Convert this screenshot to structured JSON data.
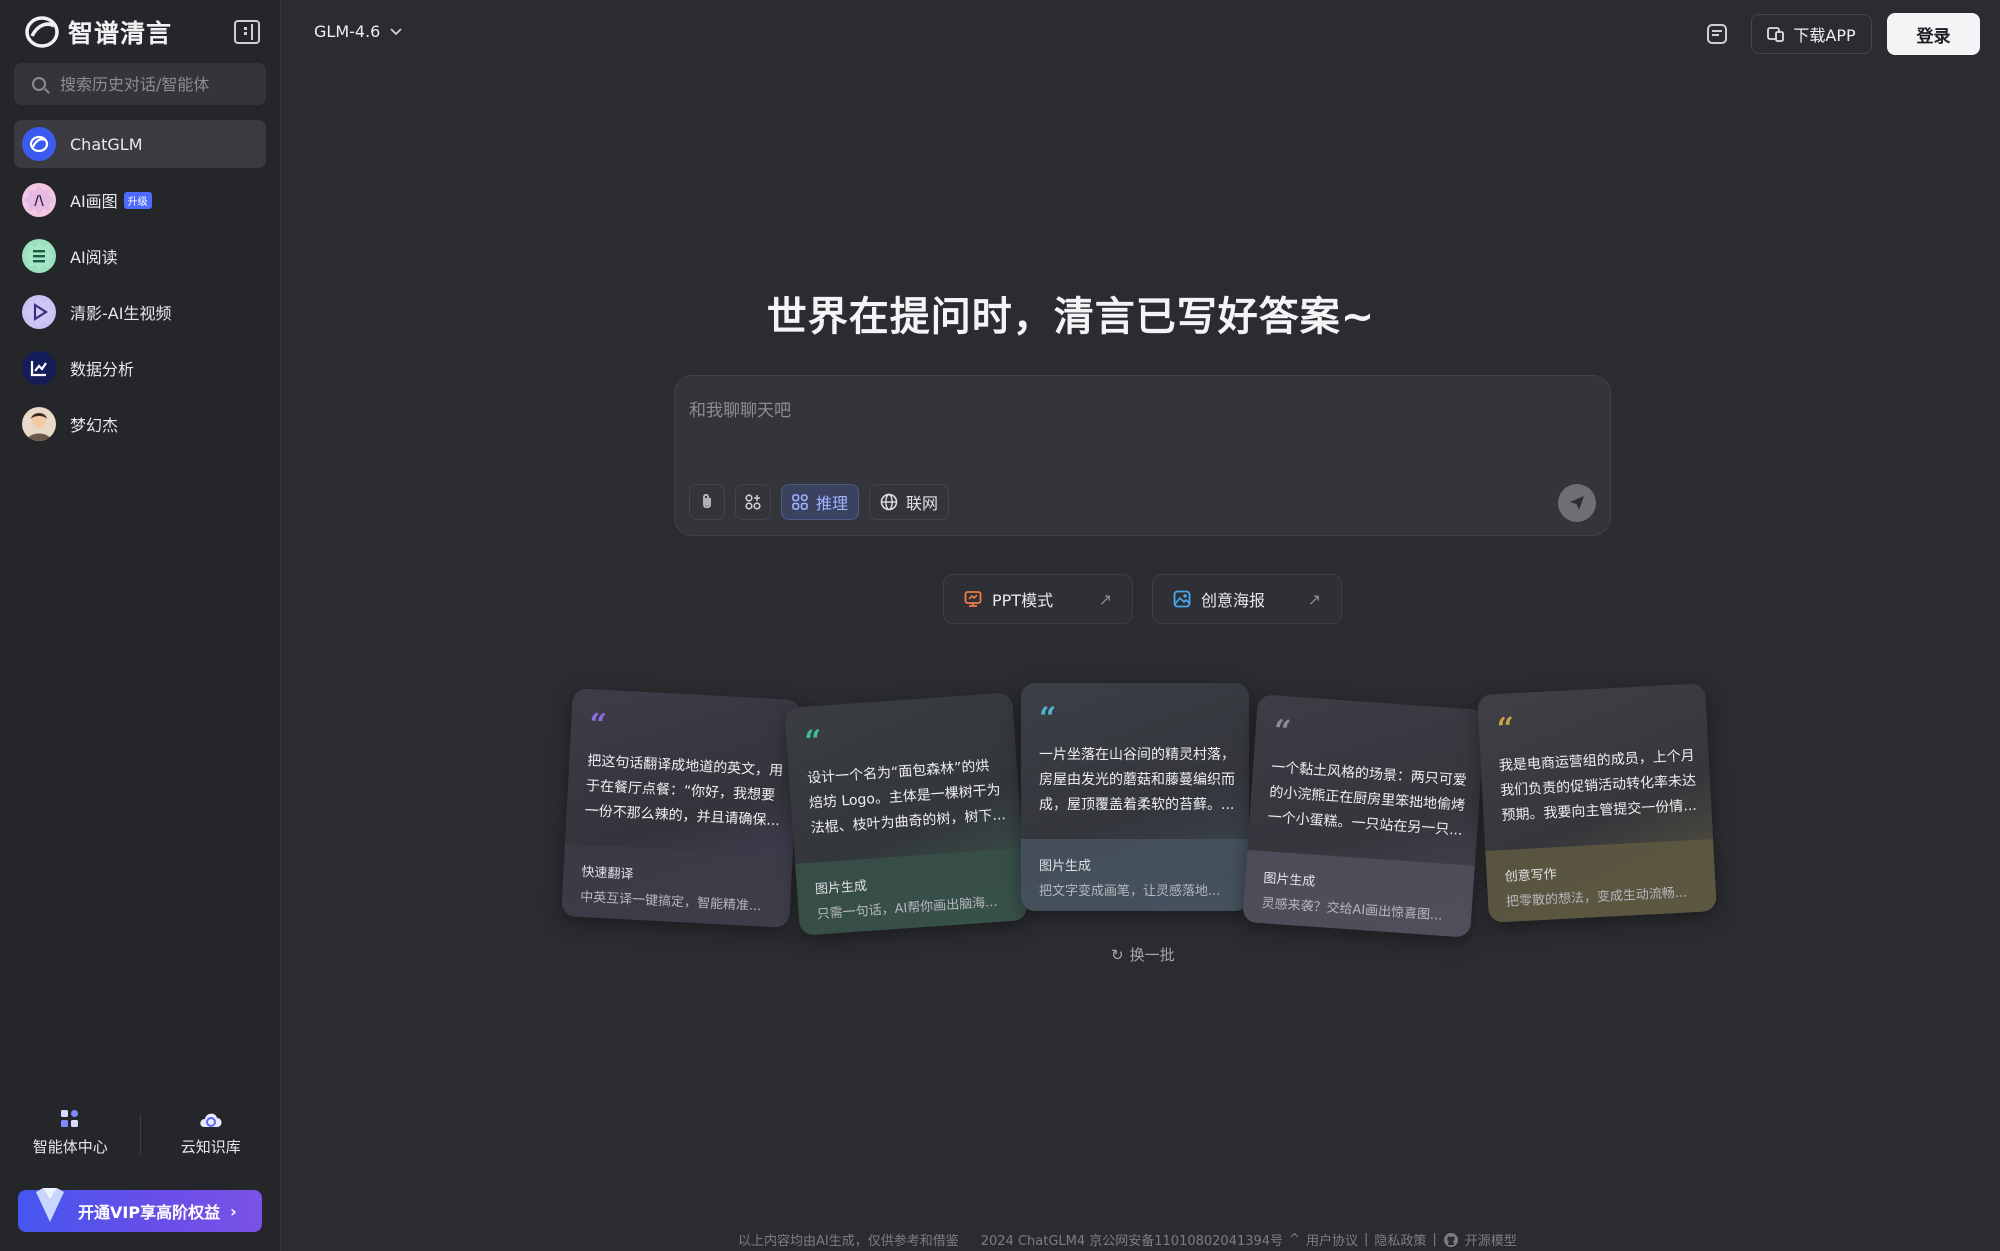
{
  "brand": {
    "name": "智谱清言"
  },
  "search": {
    "placeholder": "搜索历史对话/智能体"
  },
  "nav": [
    {
      "label": "ChatGLM",
      "icon": "chatglm-icon",
      "active": true
    },
    {
      "label": "AI画图",
      "icon": "ai-draw-icon",
      "badge": "升级"
    },
    {
      "label": "AI阅读",
      "icon": "ai-read-icon"
    },
    {
      "label": "清影-AI生视频",
      "icon": "video-icon"
    },
    {
      "label": "数据分析",
      "icon": "chart-icon"
    },
    {
      "label": "梦幻杰",
      "icon": "avatar-icon"
    }
  ],
  "bottom_tools": {
    "agents": "智能体中心",
    "knowledge": "云知识库"
  },
  "vip": {
    "label": "开通VIP享高阶权益"
  },
  "header": {
    "model": "GLM-4.6",
    "download": "下载APP",
    "login": "登录"
  },
  "main": {
    "headline": "世界在提问时，清言已写好答案~",
    "composer_placeholder": "和我聊聊天吧",
    "tools": {
      "reasoning": "推理",
      "web": "联网"
    },
    "quick": [
      {
        "label": "PPT模式"
      },
      {
        "label": "创意海报"
      }
    ],
    "refresh": "换一批"
  },
  "cards": [
    {
      "body": "把这句话翻译成地道的英文，用于在餐厅点餐：“你好，我想要一份不那么辣的，并且请确保...",
      "title": "快速翻译",
      "sub": "中英互译一键搞定，智能精准..."
    },
    {
      "body": "设计一个名为“面包森林”的烘焙坊 Logo。主体是一棵树干为法棍、枝叶为曲奇的树，树下...",
      "title": "图片生成",
      "sub": "只需一句话，AI帮你画出脑海..."
    },
    {
      "body": "一片坐落在山谷间的精灵村落，房屋由发光的蘑菇和藤蔓编织而成，屋顶覆盖着柔软的苔藓。...",
      "title": "图片生成",
      "sub": "把文字变成画笔，让灵感落地..."
    },
    {
      "body": "一个黏土风格的场景：两只可爱的小浣熊正在厨房里笨拙地偷烤一个小蛋糕。一只站在另一只...",
      "title": "图片生成",
      "sub": "灵感来袭？交给AI画出惊喜图..."
    },
    {
      "body": "我是电商运营组的成员，上个月我们负责的促销活动转化率未达预期。我要向主管提交一份情...",
      "title": "创意写作",
      "sub": "把零散的想法，变成生动流畅..."
    }
  ],
  "footer": {
    "disclaimer": "以上内容均由AI生成，仅供参考和借鉴",
    "icp": "2024 ChatGLM4 京公网安备11010802041394号",
    "agreement": "用户协议",
    "privacy": "隐私政策",
    "open": "开源模型"
  },
  "colors": {
    "accent": "#4f6bff",
    "bg": "#2b2c30",
    "sidebar": "#25262a"
  }
}
